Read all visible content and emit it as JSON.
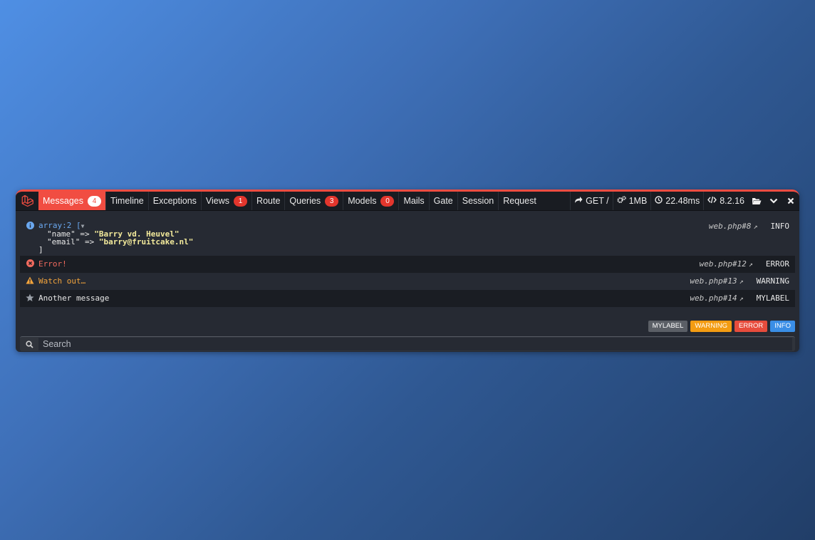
{
  "tabs": [
    {
      "label": "Messages",
      "badge": "4"
    },
    {
      "label": "Timeline"
    },
    {
      "label": "Exceptions"
    },
    {
      "label": "Views",
      "badge": "1"
    },
    {
      "label": "Route"
    },
    {
      "label": "Queries",
      "badge": "3"
    },
    {
      "label": "Models",
      "badge": "0"
    },
    {
      "label": "Mails"
    },
    {
      "label": "Gate"
    },
    {
      "label": "Session"
    },
    {
      "label": "Request"
    }
  ],
  "meta": {
    "request": "GET /",
    "memory": "1MB",
    "duration": "22.48ms",
    "php_version": "8.2.16"
  },
  "messages": [
    {
      "level": "INFO",
      "file": "web.php#8",
      "dump_head": "array:2 [",
      "dump_toggle": "▼",
      "dump_lines": [
        {
          "key": "\"name\"",
          "arrow": " => ",
          "value": "\"Barry vd. Heuvel\""
        },
        {
          "key": "\"email\"",
          "arrow": " => ",
          "value": "\"barry@fruitcake.nl\""
        }
      ],
      "dump_close": "]"
    },
    {
      "level": "ERROR",
      "file": "web.php#12",
      "text": "Error!"
    },
    {
      "level": "WARNING",
      "file": "web.php#13",
      "text": "Watch out…"
    },
    {
      "level": "MYLABEL",
      "file": "web.php#14",
      "text": "Another message"
    }
  ],
  "filters": [
    {
      "label": "MYLABEL",
      "color": "#5b5f66"
    },
    {
      "label": "WARNING",
      "color": "#f39c12"
    },
    {
      "label": "ERROR",
      "color": "#e74c3c"
    },
    {
      "label": "INFO",
      "color": "#3a8ee6"
    }
  ],
  "search": {
    "placeholder": "Search"
  },
  "colors": {
    "accent": "#f14d42",
    "info": "#6aa8f0",
    "error": "#f16a5e",
    "warning": "#f3a43c",
    "string": "#f3ea9b"
  }
}
